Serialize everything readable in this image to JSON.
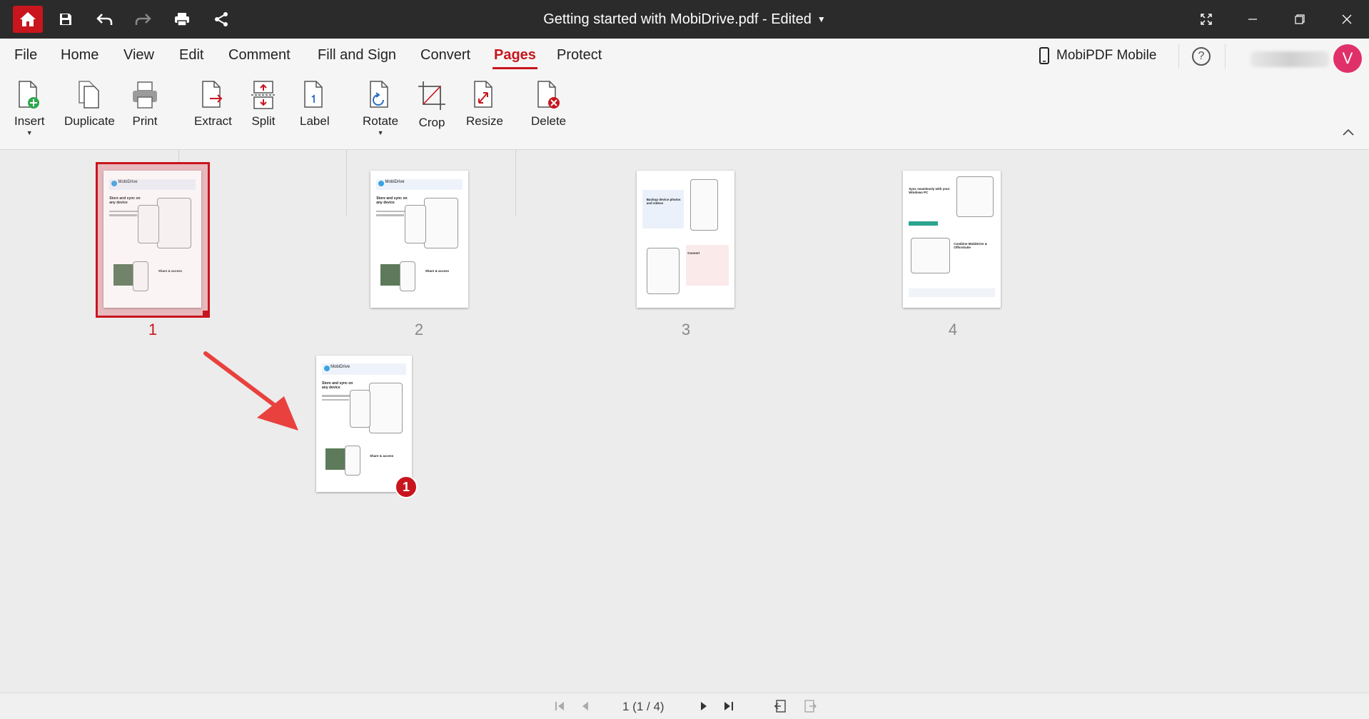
{
  "window": {
    "title": "Getting started with MobiDrive.pdf - Edited"
  },
  "menu": {
    "items": [
      "File",
      "Home",
      "View",
      "Edit",
      "Comment",
      "Fill and Sign",
      "Convert",
      "Pages",
      "Protect"
    ],
    "active": "Pages",
    "mobile_label": "MobiPDF Mobile",
    "help_label": "?",
    "avatar_initial": "V"
  },
  "ribbon": {
    "insert": "Insert",
    "duplicate": "Duplicate",
    "print": "Print",
    "extract": "Extract",
    "split": "Split",
    "label": "Label",
    "rotate": "Rotate",
    "crop": "Crop",
    "resize": "Resize",
    "delete": "Delete"
  },
  "pages": [
    {
      "number": "1",
      "selected": true
    },
    {
      "number": "2",
      "selected": false
    },
    {
      "number": "3",
      "selected": false
    },
    {
      "number": "4",
      "selected": false
    }
  ],
  "drag": {
    "count_badge": "1"
  },
  "thumb_text": {
    "brand": "MobiDrive",
    "headline_1": "Store and sync on any device",
    "headline_2": "Share & access",
    "p3_headline": "Backup device photos and videos",
    "p3_headline_2": "Convert",
    "p4_headline": "Sync seamlessly with your Windows PC",
    "p4_headline_2": "Combine MobiDrive & OfficeSuite"
  },
  "statusbar": {
    "page_indicator": "1 (1 / 4)"
  },
  "colors": {
    "accent": "#c9151d",
    "titlebar": "#2b2b2b",
    "avatar": "#e0306a"
  }
}
